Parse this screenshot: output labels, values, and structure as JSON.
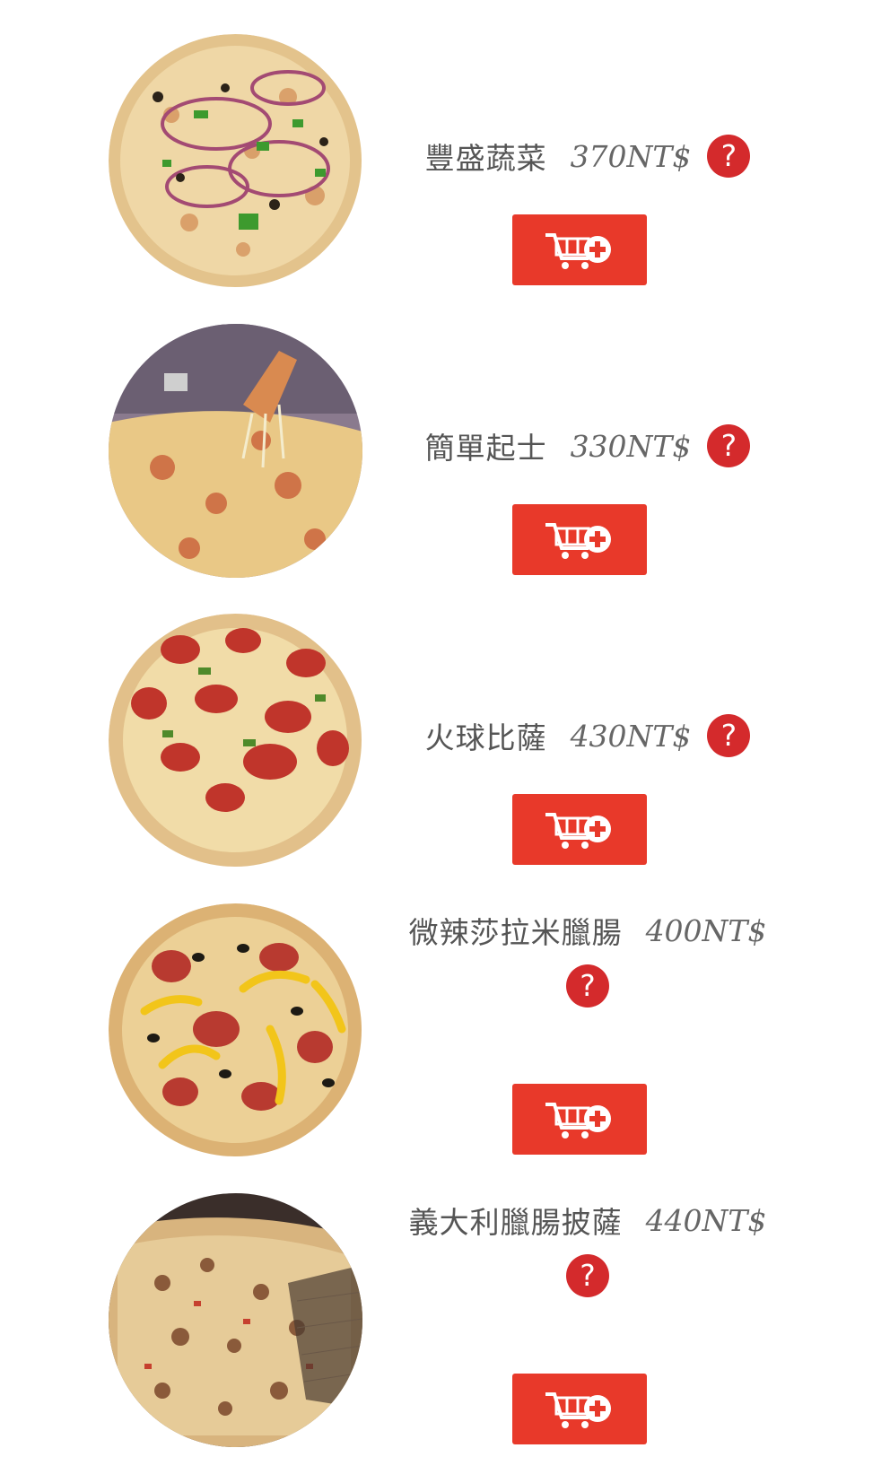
{
  "items": [
    {
      "name": "豐盛蔬菜",
      "price": "370NT$",
      "help": "?",
      "image": "pizza-veggie"
    },
    {
      "name": "簡單起士",
      "price": "330NT$",
      "help": "?",
      "image": "pizza-cheese"
    },
    {
      "name": "火球比薩",
      "price": "430NT$",
      "help": "?",
      "image": "pizza-pepperoni"
    },
    {
      "name": "微辣莎拉米臘腸",
      "price": "400NT$",
      "help": "?",
      "image": "pizza-salami"
    },
    {
      "name": "義大利臘腸披薩",
      "price": "440NT$",
      "help": "?",
      "image": "pizza-sausage"
    }
  ],
  "icons": {
    "help": "question-icon",
    "cart": "add-to-cart-icon"
  },
  "colors": {
    "accent": "#e8392a",
    "help": "#d42a2c",
    "text": "#555555"
  }
}
